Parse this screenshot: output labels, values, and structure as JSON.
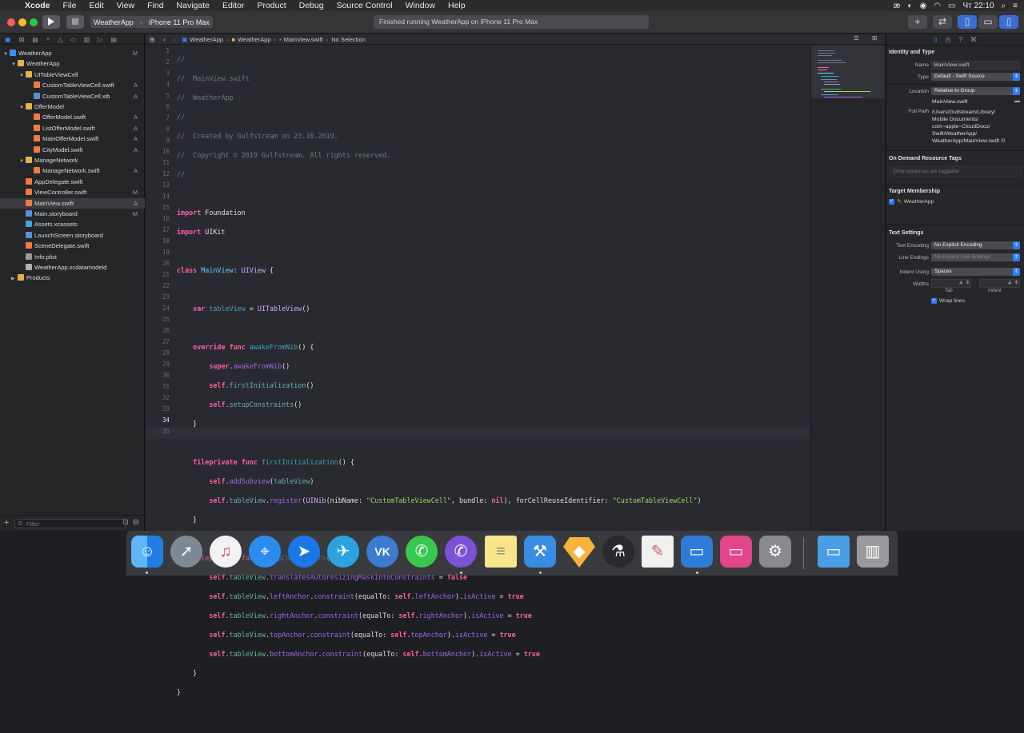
{
  "menubar": {
    "app": "Xcode",
    "items": [
      "File",
      "Edit",
      "View",
      "Find",
      "Navigate",
      "Editor",
      "Product",
      "Debug",
      "Source Control",
      "Window",
      "Help"
    ],
    "status": {
      "keyboard": "æ",
      "time": "Чт 22:10"
    }
  },
  "toolbar": {
    "scheme": "WeatherApp",
    "device": "iPhone 11 Pro Max",
    "activity": "Finished running WeatherApp on iPhone 11 Pro Max"
  },
  "navigator": {
    "filter_placeholder": "Filter",
    "tree": [
      {
        "label": "WeatherApp",
        "status": "M",
        "depth": 0,
        "kind": "project"
      },
      {
        "label": "WeatherApp",
        "status": "",
        "depth": 1,
        "kind": "folder"
      },
      {
        "label": "UITableViewCell",
        "status": "",
        "depth": 2,
        "kind": "folder"
      },
      {
        "label": "CustomTableViewCell.swift",
        "status": "A",
        "depth": 3,
        "kind": "swift"
      },
      {
        "label": "CustomTableViewCell.xib",
        "status": "A",
        "depth": 3,
        "kind": "xib"
      },
      {
        "label": "OfferModel",
        "status": "",
        "depth": 2,
        "kind": "folder"
      },
      {
        "label": "OfferModel.swift",
        "status": "A",
        "depth": 3,
        "kind": "swift"
      },
      {
        "label": "ListOfferModel.swift",
        "status": "A",
        "depth": 3,
        "kind": "swift"
      },
      {
        "label": "MainOfferModel.swift",
        "status": "A",
        "depth": 3,
        "kind": "swift"
      },
      {
        "label": "CityModel.swift",
        "status": "A",
        "depth": 3,
        "kind": "swift"
      },
      {
        "label": "ManageNetwork",
        "status": "",
        "depth": 2,
        "kind": "folder"
      },
      {
        "label": "ManageNetwork.swift",
        "status": "A",
        "depth": 3,
        "kind": "swift"
      },
      {
        "label": "AppDelegate.swift",
        "status": "",
        "depth": 2,
        "kind": "swift"
      },
      {
        "label": "ViewController.swift",
        "status": "M",
        "depth": 2,
        "kind": "swift"
      },
      {
        "label": "MainView.swift",
        "status": "A",
        "depth": 2,
        "kind": "swift"
      },
      {
        "label": "Main.storyboard",
        "status": "M",
        "depth": 2,
        "kind": "xib"
      },
      {
        "label": "Assets.xcassets",
        "status": "",
        "depth": 2,
        "kind": "assets"
      },
      {
        "label": "LaunchScreen.storyboard",
        "status": "",
        "depth": 2,
        "kind": "xib"
      },
      {
        "label": "SceneDelegate.swift",
        "status": "",
        "depth": 2,
        "kind": "swift"
      },
      {
        "label": "Info.plist",
        "status": "",
        "depth": 2,
        "kind": "plist"
      },
      {
        "label": "WeatherApp.xcdatamodeld",
        "status": "",
        "depth": 2,
        "kind": "model"
      },
      {
        "label": "Products",
        "status": "",
        "depth": 1,
        "kind": "folder"
      }
    ],
    "selected_index": 14
  },
  "jumpbar": [
    "WeatherApp",
    "WeatherApp",
    "MainView.swift",
    "No Selection"
  ],
  "editor": {
    "line_numbers": [
      "1",
      "2",
      "3",
      "4",
      "5",
      "6",
      "7",
      "8",
      "9",
      "10",
      "11",
      "12",
      "13",
      "14",
      "15",
      "16",
      "17",
      "18",
      "19",
      "20",
      "21",
      "22",
      "23",
      "24",
      "25",
      "26",
      "27",
      "28",
      "29",
      "30",
      "31",
      "32",
      "33",
      "34",
      "35"
    ],
    "current_line": "34"
  },
  "inspector": {
    "identity_title": "Identity and Type",
    "name_label": "Name",
    "name_value": "MainView.swift",
    "type_label": "Type",
    "type_value": "Default - Swift Source",
    "location_label": "Location",
    "location_value": "Relative to Group",
    "location_file": "MainView.swift",
    "fullpath_label": "Full Path",
    "fullpath_lines": [
      "/Users/Gulfstream/Library/",
      "Mobile Documents/",
      "com~apple~CloudDocs/",
      "Swift/WeatherApp/",
      "WeatherApp/MainView.swift"
    ],
    "odr_title": "On Demand Resource Tags",
    "odr_placeholder": "Only resources are taggable",
    "target_title": "Target Membership",
    "target_name": "WeatherApp",
    "text_title": "Text Settings",
    "encoding_label": "Text Encoding",
    "encoding_value": "No Explicit Encoding",
    "endings_label": "Line Endings",
    "endings_value": "No Explicit Line Endings",
    "indent_label": "Indent Using",
    "indent_value": "Spaces",
    "widths_label": "Widths",
    "tab_value": "4",
    "indent_width_value": "4",
    "tab_caption": "Tab",
    "indent_caption": "Indent",
    "wrap_label": "Wrap lines"
  },
  "dock": [
    "finder",
    "launchpad",
    "music",
    "safari",
    "direct-mail",
    "telegram",
    "vk",
    "whatsapp",
    "viber",
    "notes",
    "xcode",
    "sketch",
    "instruments",
    "textedit",
    "keynote",
    "cleanmymac",
    "system-preferences",
    "downloads-folder",
    "trash"
  ]
}
